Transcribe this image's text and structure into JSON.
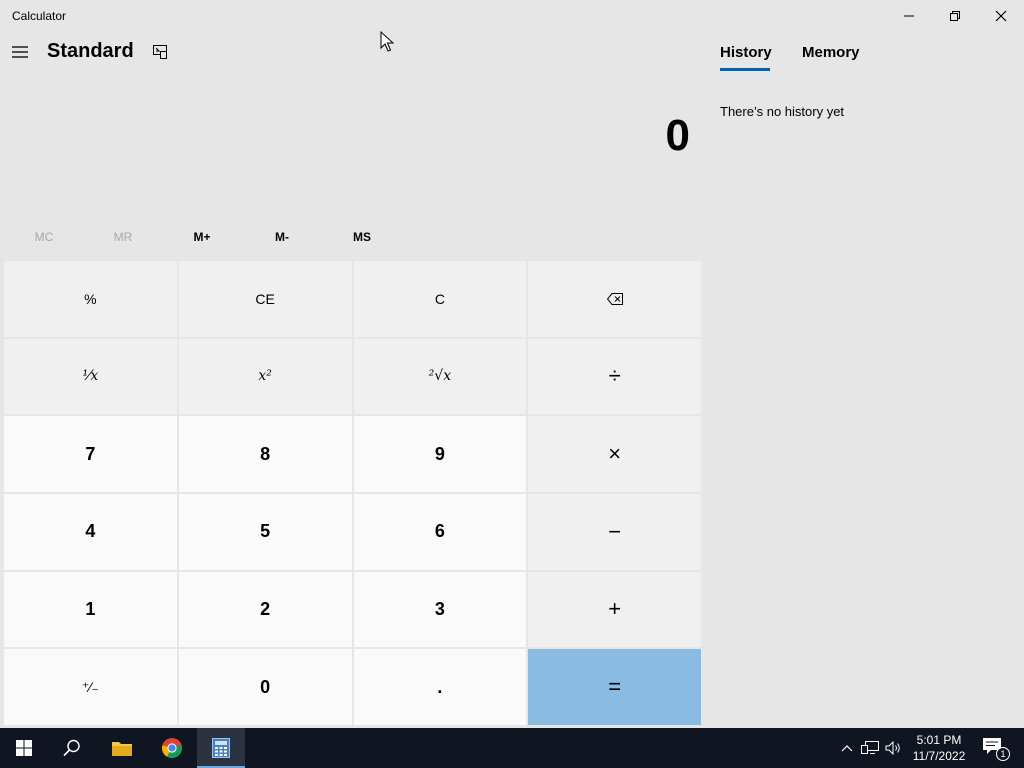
{
  "window": {
    "title": "Calculator"
  },
  "header": {
    "mode": "Standard"
  },
  "display": {
    "value": "0"
  },
  "memory": {
    "buttons": [
      {
        "label": "MC",
        "enabled": false
      },
      {
        "label": "MR",
        "enabled": false
      },
      {
        "label": "M+",
        "enabled": true
      },
      {
        "label": "M-",
        "enabled": true
      },
      {
        "label": "MS",
        "enabled": true
      }
    ]
  },
  "keypad": {
    "percent": "%",
    "clear_entry": "CE",
    "clear": "C",
    "reciprocal": "¹⁄x",
    "square": "x²",
    "sqrt": "²√x",
    "divide": "÷",
    "seven": "7",
    "eight": "8",
    "nine": "9",
    "multiply": "×",
    "four": "4",
    "five": "5",
    "six": "6",
    "minus": "−",
    "one": "1",
    "two": "2",
    "three": "3",
    "plus": "+",
    "negate": "⁺∕₋",
    "zero": "0",
    "decimal": ".",
    "equals": "="
  },
  "panel": {
    "tabs": [
      "History",
      "Memory"
    ],
    "active_tab": "History",
    "empty_message": "There’s no history yet"
  },
  "taskbar": {
    "time": "5:01 PM",
    "date": "11/7/2022",
    "notification_count": "1"
  },
  "colors": {
    "background": "#e6e6e6",
    "equals_key": "#8abbe3",
    "accent": "#0063b1",
    "taskbar": "#101621"
  }
}
